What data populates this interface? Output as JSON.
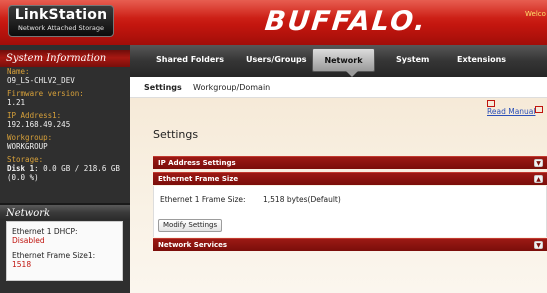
{
  "header": {
    "logo_title": "LinkStation",
    "logo_subtitle": "Network Attached Storage",
    "brand": "BUFFALO.",
    "welcome_text": "Welco"
  },
  "sidebar": {
    "system_info_title": "System Information",
    "info": [
      {
        "label": "Name:",
        "value": "O9_LS-CHLV2_DEV"
      },
      {
        "label": "Firmware version:",
        "value": "1.21"
      },
      {
        "label": "IP Address1:",
        "value": "192.168.49.245"
      },
      {
        "label": "Workgroup:",
        "value": "WORKGROUP"
      }
    ],
    "storage_label": "Storage:",
    "storage_disk": "Disk 1",
    "storage_value": ": 0.0 GB / 218.6 GB",
    "storage_percent": "(0.0 %)",
    "network_title": "Network",
    "network": [
      {
        "label": "Ethernet 1 DHCP:",
        "value": "Disabled"
      },
      {
        "label": "Ethernet Frame Size1:",
        "value": "1518"
      }
    ]
  },
  "nav": {
    "tabs": [
      "Shared Folders",
      "Users/Groups",
      "Network",
      "System",
      "Extensions"
    ],
    "active": "Network"
  },
  "subnav": {
    "tabs": [
      "Settings",
      "Workgroup/Domain"
    ],
    "active": "Settings"
  },
  "content": {
    "manual_link": "Read Manual",
    "page_title": "Settings",
    "sections": {
      "ip": "IP Address Settings",
      "frame": "Ethernet Frame Size",
      "services": "Network Services"
    },
    "frame_label": "Ethernet 1 Frame Size:",
    "frame_value": "1,518 bytes(Default)",
    "modify_button": "Modify Settings"
  },
  "colors": {
    "header_red": "#c4160f",
    "section_red": "#8a140e",
    "accent_orange": "#d8a13a",
    "link_blue": "#2a4fb8"
  },
  "icons": {
    "expand": "chevron-down-icon",
    "collapse": "chevron-up-icon",
    "external": "external-link-icon"
  }
}
